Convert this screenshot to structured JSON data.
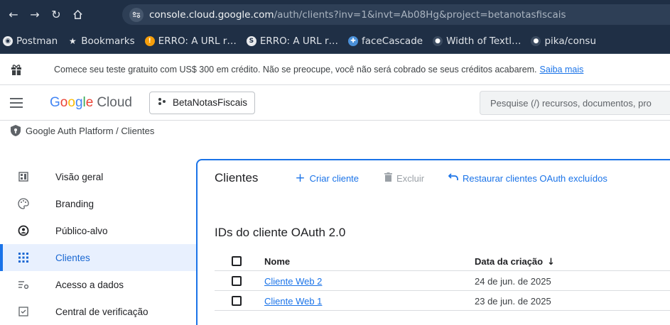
{
  "browser": {
    "url_host": "console.cloud.google.com",
    "url_rest": "/auth/clients?inv=1&invt=Ab08Hg&project=betanotasfiscais",
    "bookmarks": [
      {
        "label": "Postman",
        "icon": "postman-icon",
        "color": "#ff6c37"
      },
      {
        "label": "Bookmarks",
        "icon": "star-icon",
        "color": "#dfe3e8"
      },
      {
        "label": "ERRO: A URL r…",
        "icon": "bolt-icon",
        "color": "#f59e0b"
      },
      {
        "label": "ERRO: A URL r…",
        "icon": "stack-icon",
        "color": "#202124"
      },
      {
        "label": "faceCascade",
        "icon": "puzzle-icon",
        "color": "#4a90d9"
      },
      {
        "label": "Width of Textl…",
        "icon": "github-icon",
        "color": "#3b4b60"
      },
      {
        "label": "pika/consu",
        "icon": "github-icon",
        "color": "#3b4b60"
      }
    ]
  },
  "promo": {
    "text": "Comece seu teste gratuito com US$ 300 em crédito. Não se preocupe, você não será cobrado se seus créditos acabarem.",
    "link": "Saiba mais"
  },
  "header": {
    "logo_google": "Google",
    "logo_cloud": "Cloud",
    "project": "BetaNotasFiscais",
    "search_placeholder": "Pesquise (/) recursos, documentos, pro"
  },
  "breadcrumb": "Google Auth Platform  /  Clientes",
  "sidebar": {
    "items": [
      {
        "label": "Visão geral",
        "icon": "dashboard-icon"
      },
      {
        "label": "Branding",
        "icon": "palette-icon"
      },
      {
        "label": "Público-alvo",
        "icon": "audience-icon"
      },
      {
        "label": "Clientes",
        "icon": "grid-icon",
        "active": true
      },
      {
        "label": "Acesso a dados",
        "icon": "data-access-icon"
      },
      {
        "label": "Central de verificação",
        "icon": "verification-icon"
      }
    ]
  },
  "main": {
    "title": "Clientes",
    "create_label": "Criar cliente",
    "delete_label": "Excluir",
    "restore_label": "Restaurar clientes OAuth excluídos",
    "section_title": "IDs do cliente OAuth 2.0",
    "columns": {
      "name": "Nome",
      "date": "Data da criação"
    },
    "rows": [
      {
        "name": "Cliente Web 2",
        "date": "24 de jun. de 2025"
      },
      {
        "name": "Cliente Web 1",
        "date": "23 de jun. de 2025"
      }
    ]
  },
  "colors": {
    "accent": "#1a73e8",
    "chrome_bg": "#1f2f45"
  }
}
